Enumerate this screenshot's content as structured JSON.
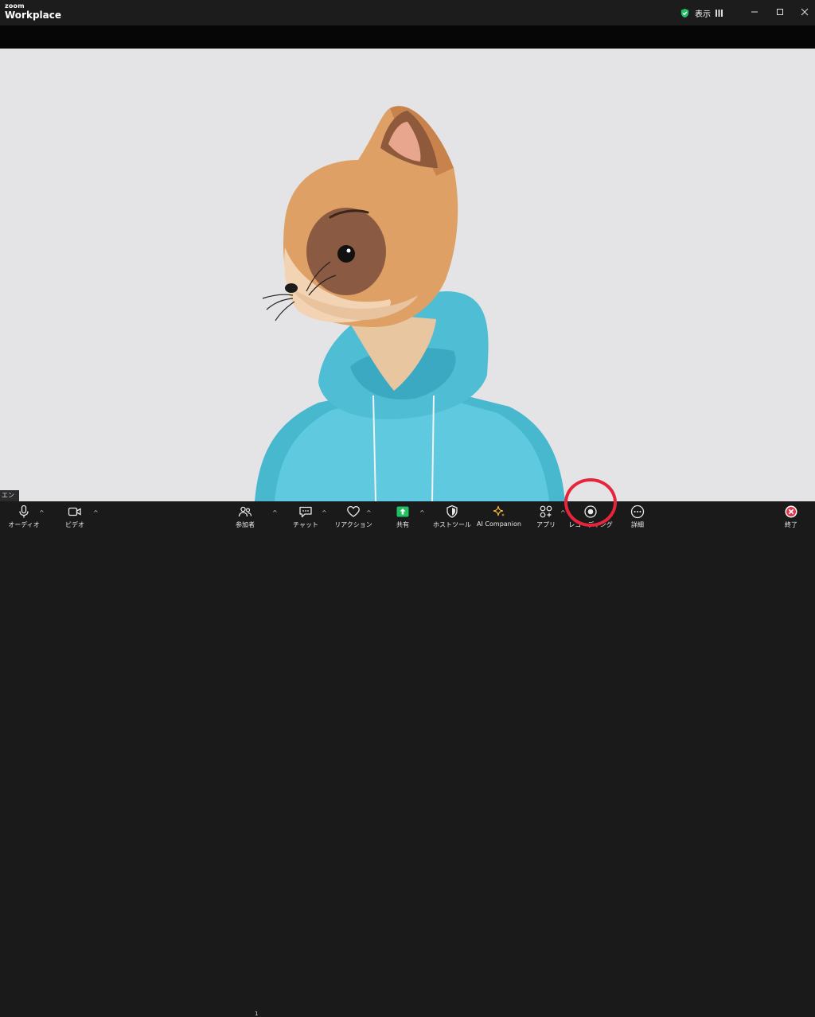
{
  "window": {
    "brand_small": "zoom",
    "brand_large": "Workplace",
    "view_label": "表示",
    "minimize_icon": "minimize-icon",
    "maximize_icon": "maximize-icon",
    "close_icon": "close-icon"
  },
  "video": {
    "participant_name": "エンド",
    "background_color": "#e4e4e6"
  },
  "toolbar": {
    "audio_label": "オーディオ",
    "video_label": "ビデオ",
    "participants_label": "参加者",
    "participants_count": "1",
    "chat_label": "チャット",
    "reactions_label": "リアクション",
    "share_label": "共有",
    "host_tools_label": "ホストツール",
    "ai_companion_label": "AI Companion",
    "apps_label": "アプリ",
    "record_label": "レコーディング",
    "more_label": "詳細",
    "end_label": "終了",
    "share_color": "#21c063",
    "ai_color": "#f5b83a",
    "end_color": "#e0364b",
    "highlight_color": "#e8243c"
  }
}
